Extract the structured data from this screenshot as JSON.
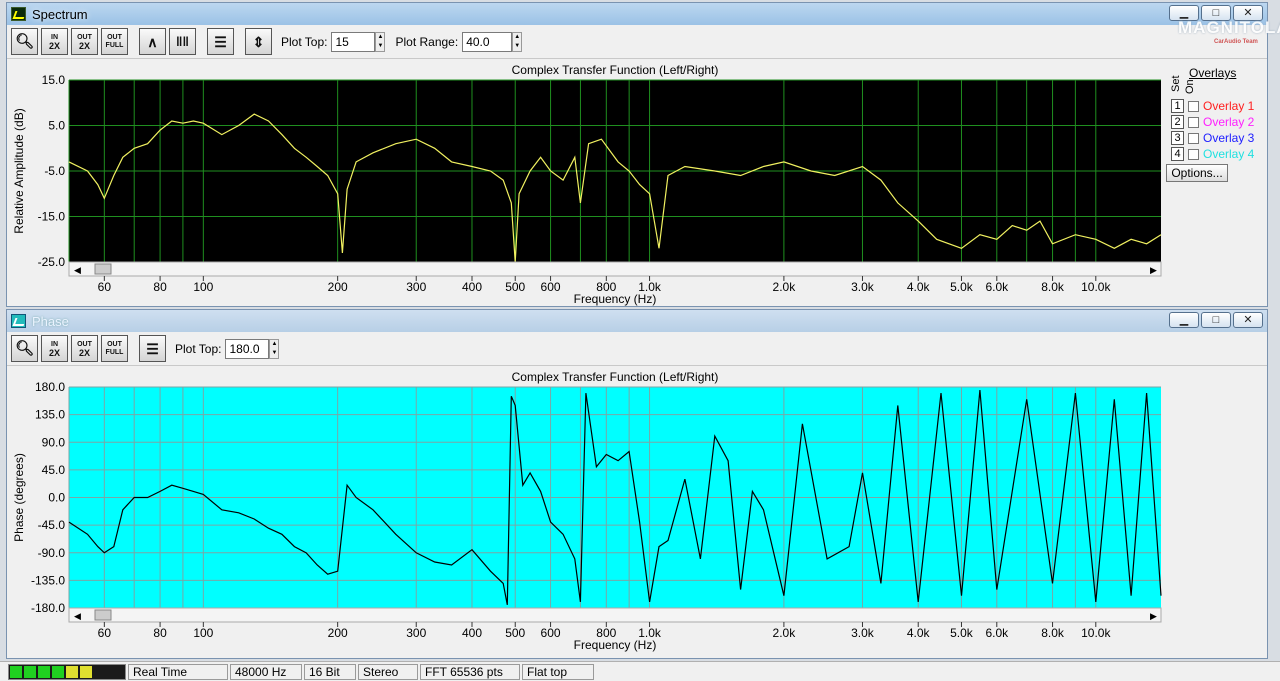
{
  "spectrum": {
    "title": "Spectrum",
    "toolbar": {
      "zoom_in_top": "IN",
      "zoom_in_bottom": "2X",
      "zoom_out_top": "OUT",
      "zoom_out_bottom": "2X",
      "zoom_full_top": "OUT",
      "zoom_full_bottom": "FULL",
      "plot_top_label": "Plot Top:",
      "plot_top_value": "15",
      "plot_range_label": "Plot Range:",
      "plot_range_value": "40.0"
    },
    "plot": {
      "title": "Complex Transfer Function (Left/Right)",
      "ylabel": "Relative Amplitude (dB)",
      "xlabel": "Frequency (Hz)",
      "bg": "#000000",
      "grid": "#1f8f1f",
      "trace": "#f0f060"
    }
  },
  "overlays": {
    "title": "Overlays",
    "col_set": "Set",
    "col_on": "On",
    "items": [
      {
        "num": "1",
        "label": "Overlay 1",
        "color": "#ff2020"
      },
      {
        "num": "2",
        "label": "Overlay 2",
        "color": "#ff20ff"
      },
      {
        "num": "3",
        "label": "Overlay 3",
        "color": "#2020ff"
      },
      {
        "num": "4",
        "label": "Overlay 4",
        "color": "#20e0e0"
      }
    ],
    "options_label": "Options..."
  },
  "phase": {
    "title": "Phase",
    "toolbar": {
      "plot_top_label": "Plot Top:",
      "plot_top_value": "180.0"
    },
    "plot": {
      "title": "Complex Transfer Function (Left/Right)",
      "ylabel": "Phase (degrees)",
      "xlabel": "Frequency (Hz)",
      "bg": "#00ffff",
      "grid": "#7aa6a6",
      "trace": "#000000"
    }
  },
  "window_buttons": {
    "minimize": "▁",
    "maximize": "□",
    "close": "✕"
  },
  "logo": {
    "text": "MAGNITOLA",
    "sub": "CarAudio Team"
  },
  "status": {
    "mode": "Real Time",
    "rate": "48000 Hz",
    "bits": "16 Bit",
    "channels": "Stereo",
    "fft": "FFT 65536 pts",
    "window": "Flat top"
  },
  "chart_data": [
    {
      "type": "line",
      "title": "Complex Transfer Function (Left/Right)",
      "xlabel": "Frequency (Hz)",
      "ylabel": "Relative Amplitude (dB)",
      "x_scale": "log",
      "xlim": [
        50,
        14000
      ],
      "ylim": [
        -25,
        15
      ],
      "x_ticks": [
        60,
        80,
        100,
        200,
        300,
        400,
        500,
        600,
        800,
        1000,
        2000,
        3000,
        4000,
        5000,
        6000,
        8000,
        10000
      ],
      "x_tick_labels": [
        "60",
        "80",
        "100",
        "200",
        "300",
        "400",
        "500",
        "600",
        "800",
        "1.0k",
        "2.0k",
        "3.0k",
        "4.0k",
        "5.0k",
        "6.0k",
        "8.0k",
        "10.0k"
      ],
      "y_ticks": [
        15,
        5,
        -5,
        -15,
        -25
      ],
      "y_tick_labels": [
        "15.0",
        "5.0",
        "-5.0",
        "-15.0",
        "-25.0"
      ],
      "grid": true,
      "x": [
        50,
        55,
        58,
        60,
        63,
        66,
        70,
        75,
        80,
        85,
        90,
        95,
        100,
        110,
        120,
        130,
        140,
        150,
        160,
        170,
        180,
        190,
        200,
        205,
        210,
        220,
        240,
        270,
        300,
        330,
        360,
        400,
        440,
        470,
        490,
        500,
        510,
        540,
        570,
        600,
        640,
        680,
        700,
        730,
        780,
        850,
        900,
        950,
        1000,
        1050,
        1100,
        1200,
        1400,
        1600,
        1800,
        2000,
        2300,
        2600,
        3000,
        3300,
        3600,
        4000,
        4400,
        5000,
        5500,
        6000,
        6500,
        7000,
        7500,
        8000,
        9000,
        10000,
        11000,
        12000,
        13000,
        14000
      ],
      "y": [
        -3,
        -5,
        -8,
        -11,
        -6,
        -2,
        0,
        1,
        4,
        6,
        5.5,
        6,
        5.5,
        3,
        5,
        7.5,
        6,
        3,
        0,
        -2,
        -4,
        -6,
        -10,
        -23,
        -9,
        -3,
        -1,
        1,
        2,
        0,
        -3,
        -4,
        -5,
        -7,
        -12,
        -25,
        -10,
        -5,
        -2,
        -5,
        -7,
        -2,
        -12,
        1,
        2,
        -3,
        -5,
        -8,
        -10,
        -22,
        -6,
        -4,
        -5,
        -6,
        -4,
        -3,
        -5,
        -6,
        -4,
        -7,
        -12,
        -16,
        -20,
        -22,
        -19,
        -20,
        -17,
        -18,
        -16,
        -21,
        -19,
        -20,
        -22,
        -20,
        -21,
        -19
      ]
    },
    {
      "type": "line",
      "title": "Complex Transfer Function (Left/Right)",
      "xlabel": "Frequency (Hz)",
      "ylabel": "Phase (degrees)",
      "x_scale": "log",
      "xlim": [
        50,
        14000
      ],
      "ylim": [
        -180,
        180
      ],
      "x_ticks": [
        60,
        80,
        100,
        200,
        300,
        400,
        500,
        600,
        800,
        1000,
        2000,
        3000,
        4000,
        5000,
        6000,
        8000,
        10000
      ],
      "x_tick_labels": [
        "60",
        "80",
        "100",
        "200",
        "300",
        "400",
        "500",
        "600",
        "800",
        "1.0k",
        "2.0k",
        "3.0k",
        "4.0k",
        "5.0k",
        "6.0k",
        "8.0k",
        "10.0k"
      ],
      "y_ticks": [
        180,
        135,
        90,
        45,
        0,
        -45,
        -90,
        -135,
        -180
      ],
      "y_tick_labels": [
        "180.0",
        "135.0",
        "90.0",
        "45.0",
        "0.0",
        "-45.0",
        "-90.0",
        "-135.0",
        "-180.0"
      ],
      "grid": true,
      "x": [
        50,
        55,
        58,
        60,
        63,
        66,
        70,
        75,
        80,
        85,
        90,
        95,
        100,
        110,
        120,
        130,
        140,
        150,
        160,
        170,
        180,
        190,
        200,
        210,
        220,
        240,
        270,
        300,
        330,
        360,
        400,
        440,
        470,
        480,
        490,
        500,
        520,
        540,
        570,
        600,
        640,
        680,
        700,
        720,
        760,
        800,
        850,
        900,
        950,
        1000,
        1050,
        1100,
        1200,
        1300,
        1400,
        1500,
        1600,
        1700,
        1800,
        2000,
        2200,
        2500,
        2800,
        3000,
        3300,
        3600,
        4000,
        4500,
        5000,
        5500,
        6000,
        7000,
        8000,
        9000,
        10000,
        11000,
        12000,
        13000,
        14000
      ],
      "y": [
        -40,
        -60,
        -80,
        -90,
        -80,
        -20,
        0,
        0,
        10,
        20,
        15,
        10,
        5,
        -20,
        -25,
        -35,
        -50,
        -60,
        -80,
        -90,
        -110,
        -125,
        -120,
        20,
        0,
        -20,
        -60,
        -90,
        -105,
        -110,
        -85,
        -120,
        -140,
        -175,
        165,
        150,
        20,
        40,
        10,
        -40,
        -60,
        -100,
        -170,
        170,
        50,
        70,
        60,
        75,
        -40,
        -170,
        -80,
        -70,
        30,
        -100,
        100,
        60,
        -150,
        10,
        -20,
        -160,
        120,
        -100,
        -80,
        40,
        -140,
        150,
        -170,
        170,
        -160,
        175,
        -150,
        160,
        -140,
        170,
        -170,
        160,
        -160,
        170,
        -160
      ]
    }
  ]
}
